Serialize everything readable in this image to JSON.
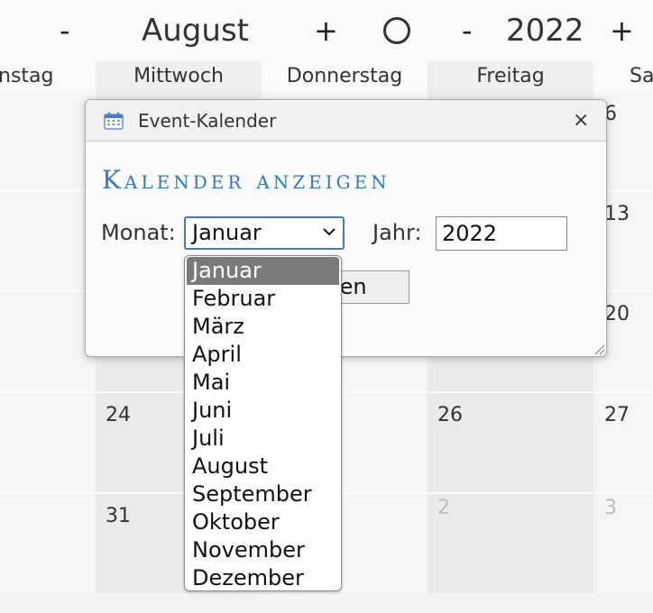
{
  "nav": {
    "month_minus": "-",
    "month": "August",
    "month_plus": "+",
    "year_minus": "-",
    "year": "2022",
    "year_plus": "+"
  },
  "weekdays": [
    "nstag",
    "Mittwoch",
    "Donnerstag",
    "Freitag",
    "Sa"
  ],
  "days": {
    "sat_r1": "6",
    "sat_r2": "13",
    "sat_r3": "20",
    "wed_r4": "24",
    "fri_r4": "26",
    "sat_r4": "27",
    "wed_r5": "31",
    "fri_r5": "2",
    "sat_r5": "3"
  },
  "dialog": {
    "title": "Event-Kalender",
    "close": "×",
    "heading": "Kalender anzeigen",
    "month_label": "Monat:",
    "month_value": "Januar",
    "year_label": "Jahr:",
    "year_value": "2022",
    "show_button": "eigen"
  },
  "dropdown": {
    "options": [
      "Januar",
      "Februar",
      "März",
      "April",
      "Mai",
      "Juni",
      "Juli",
      "August",
      "September",
      "Oktober",
      "November",
      "Dezember"
    ],
    "selected_index": 0
  },
  "colors": {
    "accent": "#3178c6",
    "selected_option_bg": "#7a7a7a"
  }
}
